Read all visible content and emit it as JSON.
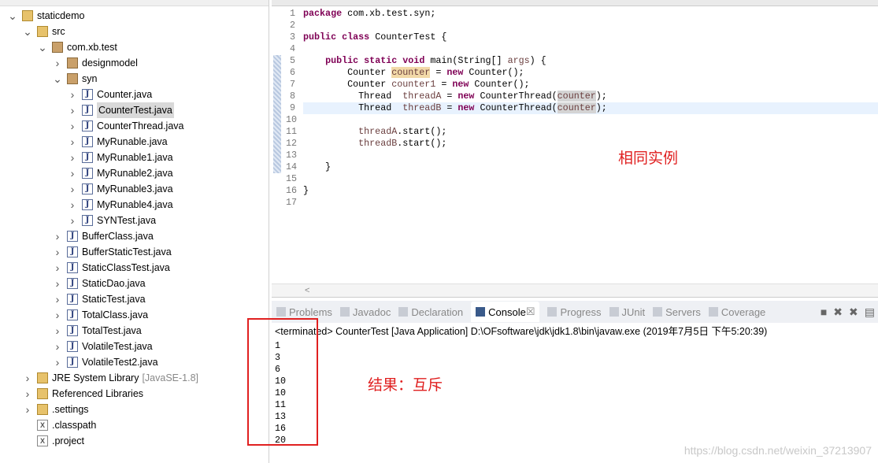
{
  "tree": [
    {
      "label": "staticdemo",
      "depth": 0,
      "twisty": "v",
      "icon": "f"
    },
    {
      "label": "src",
      "depth": 1,
      "twisty": "v",
      "icon": "f"
    },
    {
      "label": "com.xb.test",
      "depth": 2,
      "twisty": "v",
      "icon": "p"
    },
    {
      "label": "designmodel",
      "depth": 3,
      "twisty": ">",
      "icon": "p"
    },
    {
      "label": "syn",
      "depth": 3,
      "twisty": "v",
      "icon": "p"
    },
    {
      "label": "Counter.java",
      "depth": 4,
      "twisty": ">",
      "icon": "j"
    },
    {
      "label": "CounterTest.java",
      "depth": 4,
      "twisty": ">",
      "icon": "j",
      "selected": true
    },
    {
      "label": "CounterThread.java",
      "depth": 4,
      "twisty": ">",
      "icon": "j"
    },
    {
      "label": "MyRunable.java",
      "depth": 4,
      "twisty": ">",
      "icon": "j"
    },
    {
      "label": "MyRunable1.java",
      "depth": 4,
      "twisty": ">",
      "icon": "j"
    },
    {
      "label": "MyRunable2.java",
      "depth": 4,
      "twisty": ">",
      "icon": "j"
    },
    {
      "label": "MyRunable3.java",
      "depth": 4,
      "twisty": ">",
      "icon": "j"
    },
    {
      "label": "MyRunable4.java",
      "depth": 4,
      "twisty": ">",
      "icon": "j"
    },
    {
      "label": "SYNTest.java",
      "depth": 4,
      "twisty": ">",
      "icon": "j"
    },
    {
      "label": "BufferClass.java",
      "depth": 3,
      "twisty": ">",
      "icon": "j"
    },
    {
      "label": "BufferStaticTest.java",
      "depth": 3,
      "twisty": ">",
      "icon": "j"
    },
    {
      "label": "StaticClassTest.java",
      "depth": 3,
      "twisty": ">",
      "icon": "j"
    },
    {
      "label": "StaticDao.java",
      "depth": 3,
      "twisty": ">",
      "icon": "j"
    },
    {
      "label": "StaticTest.java",
      "depth": 3,
      "twisty": ">",
      "icon": "j"
    },
    {
      "label": "TotalClass.java",
      "depth": 3,
      "twisty": ">",
      "icon": "j"
    },
    {
      "label": "TotalTest.java",
      "depth": 3,
      "twisty": ">",
      "icon": "j"
    },
    {
      "label": "VolatileTest.java",
      "depth": 3,
      "twisty": ">",
      "icon": "j"
    },
    {
      "label": "VolatileTest2.java",
      "depth": 3,
      "twisty": ">",
      "icon": "j"
    },
    {
      "label": "JRE System Library",
      "suffix": "[JavaSE-1.8]",
      "depth": 1,
      "twisty": ">",
      "icon": "f"
    },
    {
      "label": "Referenced Libraries",
      "depth": 1,
      "twisty": ">",
      "icon": "f"
    },
    {
      "label": ".settings",
      "depth": 1,
      "twisty": ">",
      "icon": "f"
    },
    {
      "label": ".classpath",
      "depth": 1,
      "twisty": "",
      "icon": "x"
    },
    {
      "label": ".project",
      "depth": 1,
      "twisty": "",
      "icon": "x"
    }
  ],
  "code": [
    "<k>package</k> com.xb.test.syn;",
    "",
    "<k>public</k> <k>class</k> CounterTest {",
    "",
    "    <k>public</k> <k>static</k> <k>void</k> main(String[] <v>args</v>) {",
    "        Counter <h>counter</h> = <k>new</k> Counter();",
    "        Counter <v>counter1</v> = <k>new</k> Counter();",
    "          Thread  <v>threadA</v> = <k>new</k> CounterThread(<g>counter</g>);",
    "          Thread  <v>threadB</v> = <k>new</k> CounterThread(<g>counter</g>);",
    "",
    "          <v>threadA</v>.start();",
    "          <v>threadB</v>.start();",
    "",
    "    }",
    "",
    "}",
    ""
  ],
  "current_line": 9,
  "annotation_code": "相同实例",
  "annotation_console": "结果：互斥",
  "console": {
    "tabs": [
      "Problems",
      "Javadoc",
      "Declaration",
      "Console",
      "Progress",
      "JUnit",
      "Servers",
      "Coverage"
    ],
    "active_tab": "Console",
    "status": "<terminated> CounterTest [Java Application] D:\\OFsoftware\\jdk\\jdk1.8\\bin\\javaw.exe (2019年7月5日 下午5:20:39)",
    "output": [
      "1",
      "3",
      "6",
      "10",
      "10",
      "11",
      "13",
      "16",
      "20"
    ]
  },
  "watermark": "https://blog.csdn.net/weixin_37213907",
  "colors": {
    "keyword": "#7f0055",
    "annotation": "#e02020"
  }
}
